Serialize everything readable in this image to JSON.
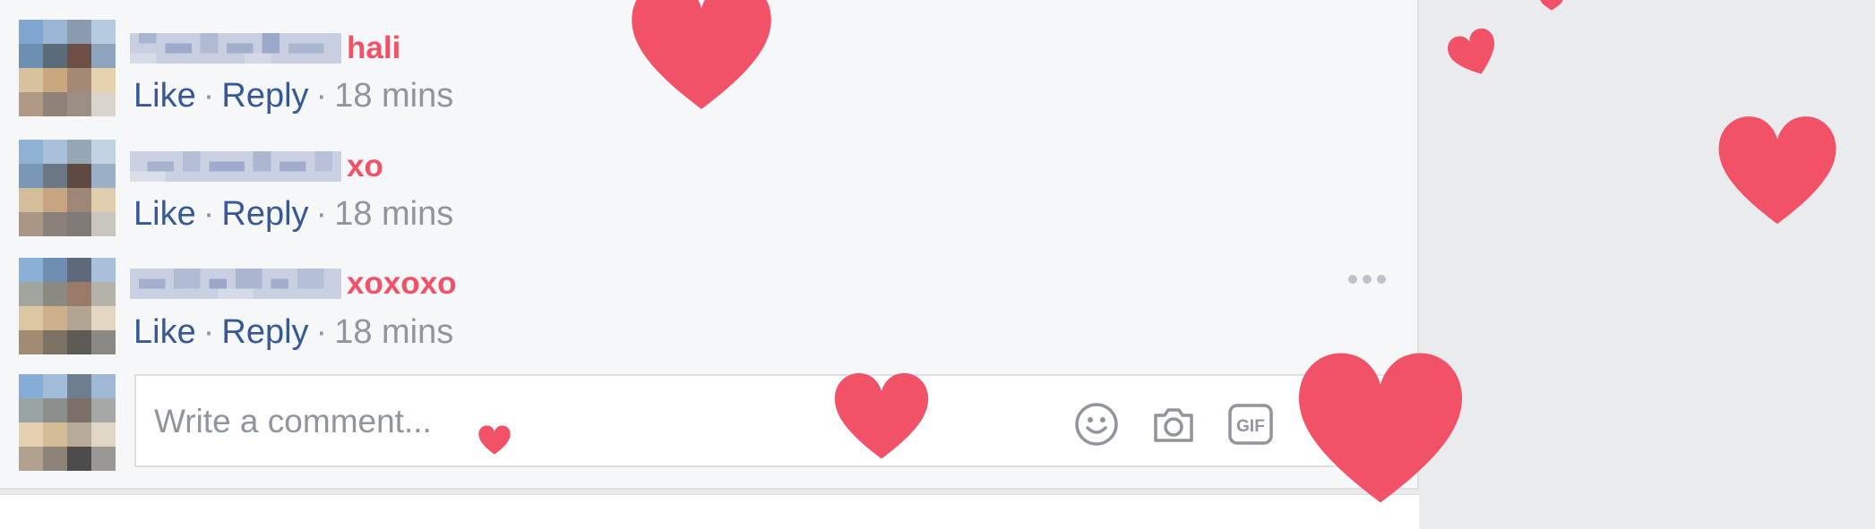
{
  "comments": [
    {
      "name_fragment": "hali",
      "like_label": "Like",
      "reply_label": "Reply",
      "separator": "·",
      "timestamp": "18 mins"
    },
    {
      "name_fragment": "xo",
      "like_label": "Like",
      "reply_label": "Reply",
      "separator": "·",
      "timestamp": "18 mins"
    },
    {
      "name_fragment": "xoxoxo",
      "like_label": "Like",
      "reply_label": "Reply",
      "separator": "·",
      "timestamp": "18 mins"
    }
  ],
  "composer": {
    "placeholder": "Write a comment...",
    "icons": [
      "emoji-icon",
      "camera-icon",
      "gif-icon"
    ],
    "gif_label": "GIF"
  },
  "colors": {
    "link": "#365899",
    "name_highlight": "#f25268",
    "meta_text": "#90949c",
    "heart": "#f25268",
    "panel_bg": "#f6f7f9",
    "page_bg": "#e9ebee"
  }
}
